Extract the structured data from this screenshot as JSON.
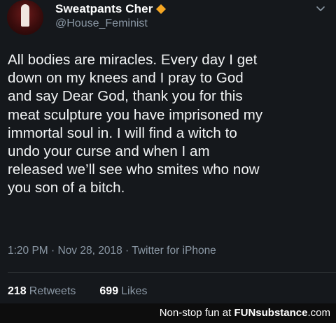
{
  "tweet": {
    "author_name": "Sweatpants Cher",
    "author_handle": "@House_Feminist",
    "badge_icon": "orange-diamond-icon",
    "menu_icon": "chevron-down-icon",
    "text": "All bodies are miracles. Every day I get\ndown on my knees and I pray to God\nand say Dear God, thank you for this\nmeat sculpture you have imprisoned my\nimmortal soul in. I will find a witch to\nundo your curse and when I am\nreleased we’ll see who smites who now\nyou son of a bitch.",
    "meta": "1:20 PM · Nov 28, 2018 · Twitter for iPhone",
    "retweets_count": "218",
    "retweets_label": "Retweets",
    "likes_count": "699",
    "likes_label": "Likes"
  },
  "watermark": {
    "prefix": "Non-stop fun at ",
    "brand": "FUNsubstance",
    "suffix": ".com"
  },
  "colors": {
    "background": "#15181c",
    "text_primary": "#f2f4f5",
    "text_secondary": "#8b98a5",
    "badge": "#f5a623"
  }
}
